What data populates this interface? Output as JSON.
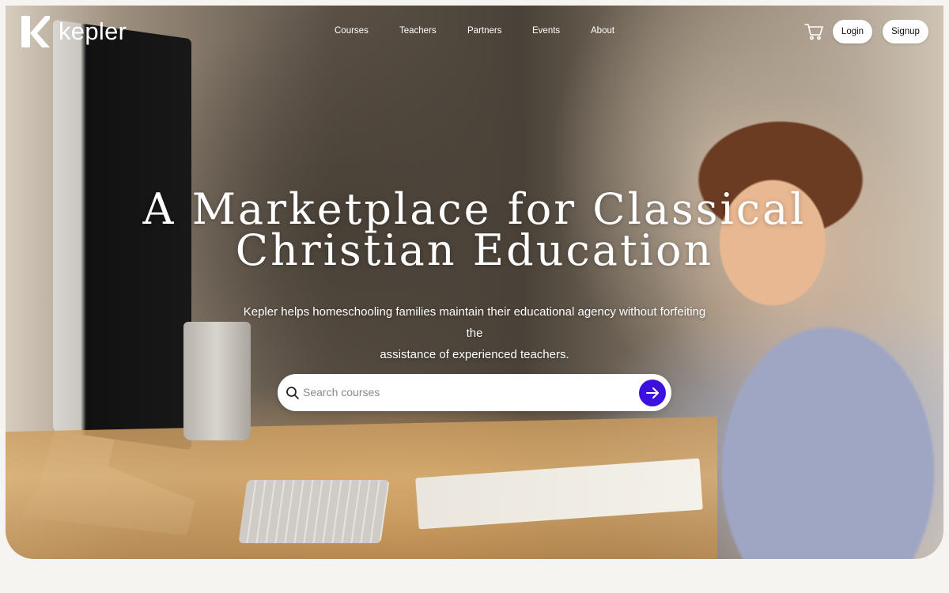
{
  "brand": {
    "name": "kepler"
  },
  "nav": {
    "links": [
      "Courses",
      "Teachers",
      "Partners",
      "Events",
      "About"
    ],
    "login_label": "Login",
    "signup_label": "Signup"
  },
  "hero": {
    "headline_line1": "A Marketplace for Classical",
    "headline_line2": "Christian Education",
    "subhead_line1": "Kepler helps homeschooling families maintain their educational agency without forfeiting the",
    "subhead_line2": "assistance of experienced teachers."
  },
  "search": {
    "placeholder": "Search courses",
    "value": ""
  },
  "icons": {
    "cart": "shopping-cart-icon",
    "search": "search-icon",
    "submit": "arrow-right-icon"
  },
  "colors": {
    "accent": "#3d10e0",
    "page_background": "#f6f4f0",
    "button_bg": "#ffffff"
  }
}
